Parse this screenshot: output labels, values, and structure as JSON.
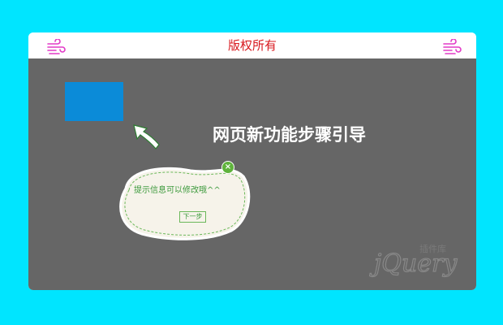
{
  "header": {
    "title": "版权所有",
    "left_icon": "wind-icon",
    "right_icon": "wind-icon",
    "title_color": "#d8191f",
    "icon_color": "#e23ac7"
  },
  "stage": {
    "background": "#666666",
    "highlight_color": "#0b8bd8",
    "guide_title": "网页新功能步骤引导"
  },
  "tooltip": {
    "text": "提示信息可以修改哦^^",
    "next_label": "下一步",
    "close_icon": "close-icon",
    "close_glyph": "×"
  },
  "watermark": {
    "brand": "jQuery",
    "subtitle": "插件库"
  },
  "colors": {
    "page_background": "#00e5ff",
    "accent_green": "#5fb33c"
  }
}
